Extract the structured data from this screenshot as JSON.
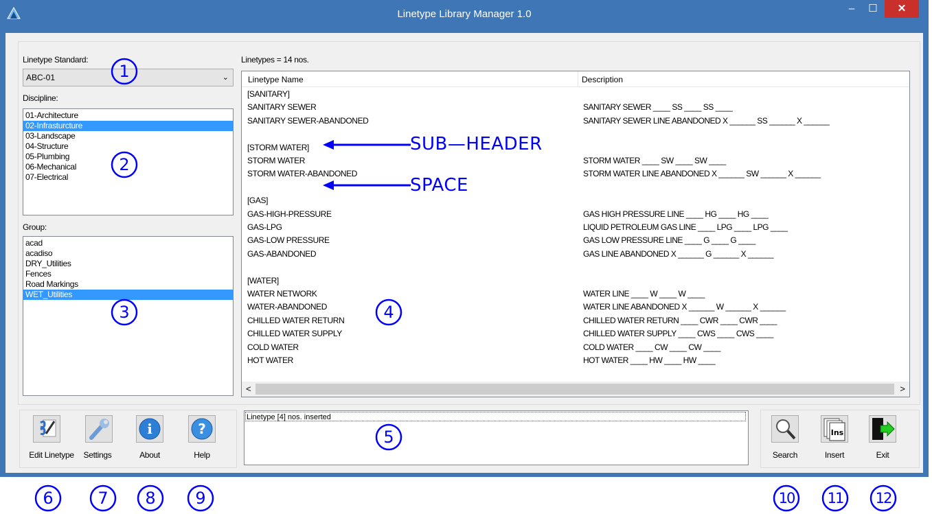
{
  "window": {
    "title": "Linetype Library Manager 1.0",
    "min_glyph": "–",
    "max_glyph": "☐",
    "close_glyph": "✕"
  },
  "left": {
    "standard_label": "Linetype Standard:",
    "standard_value": "ABC-01",
    "discipline_label": "Discipline:",
    "disciplines": [
      "01-Architecture",
      "02-Infrasturcture",
      "03-Landscape",
      "04-Structure",
      "05-Plumbing",
      "06-Mechanical",
      "07-Electrical"
    ],
    "discipline_selected": 1,
    "group_label": "Group:",
    "groups": [
      "acad",
      "acadiso",
      "DRY_Utilities",
      "Fences",
      "Road Markings",
      "WET_Utilities"
    ],
    "group_selected": 5
  },
  "linetypes": {
    "count_label": "Linetypes = 14 nos.",
    "col_name": "Linetype Name",
    "col_desc": "Description",
    "rows": [
      {
        "name": "[SANITARY]",
        "desc": ""
      },
      {
        "name": "SANITARY SEWER",
        "desc": "SANITARY SEWER ____ SS ____ SS ____"
      },
      {
        "name": "SANITARY SEWER-ABANDONED",
        "desc": "SANITARY SEWER LINE ABANDONED X ______ SS ______ X ______"
      },
      {
        "name": "",
        "desc": ""
      },
      {
        "name": "[STORM WATER]",
        "desc": ""
      },
      {
        "name": "STORM WATER",
        "desc": "STORM WATER ____ SW ____ SW ____"
      },
      {
        "name": "STORM WATER-ABANDONED",
        "desc": "STORM WATER LINE ABANDONED X ______ SW ______ X ______"
      },
      {
        "name": "",
        "desc": ""
      },
      {
        "name": "[GAS]",
        "desc": ""
      },
      {
        "name": "GAS-HIGH-PRESSURE",
        "desc": "GAS HIGH PRESSURE LINE ____ HG ____ HG ____"
      },
      {
        "name": "GAS-LPG",
        "desc": "LIQUID PETROLEUM GAS LINE ____ LPG ____ LPG ____"
      },
      {
        "name": "GAS-LOW PRESSURE",
        "desc": "GAS LOW PRESSURE LINE ____ G ____ G ____"
      },
      {
        "name": "GAS-ABANDONED",
        "desc": "GAS LINE ABANDONED X ______ G ______ X ______"
      },
      {
        "name": "",
        "desc": ""
      },
      {
        "name": "[WATER]",
        "desc": ""
      },
      {
        "name": "WATER NETWORK",
        "desc": "WATER LINE ____ W ____ W ____"
      },
      {
        "name": "WATER-ABANDONED",
        "desc": "WATER LINE ABANDONED X ______ W ______ X ______"
      },
      {
        "name": "CHILLED WATER RETURN",
        "desc": "CHILLED WATER RETURN ____ CWR ____ CWR ____"
      },
      {
        "name": "CHILLED WATER SUPPLY",
        "desc": "CHILLED WATER SUPPLY ____ CWS ____ CWS ____"
      },
      {
        "name": "COLD WATER",
        "desc": "COLD WATER ____ CW ____ CW ____"
      },
      {
        "name": "HOT WATER",
        "desc": "HOT WATER ____ HW ____ HW ____"
      }
    ],
    "scroll_left": "<",
    "scroll_right": ">"
  },
  "status": {
    "message": "Linetype [4] nos. inserted"
  },
  "toolbar": {
    "edit_label": "Edit Linetype",
    "settings_label": "Settings",
    "about_label": "About",
    "help_label": "Help",
    "search_label": "Search",
    "insert_label": "Insert",
    "exit_label": "Exit",
    "insert_icon_text": "Ins",
    "help_icon_text": "?",
    "about_icon_text": "i"
  },
  "annotations": {
    "sub_header": "SUB—HEADER",
    "space": "SPACE",
    "n1": "1",
    "n2": "2",
    "n3": "3",
    "n4": "4",
    "n5": "5",
    "n6": "6",
    "n7": "7",
    "n8": "8",
    "n9": "9",
    "n10": "10",
    "n11": "11",
    "n12": "12"
  },
  "colors": {
    "title_bar": "#3f76b5",
    "selection": "#3399ff",
    "annotation": "#0000ff",
    "close": "#c9302c"
  }
}
